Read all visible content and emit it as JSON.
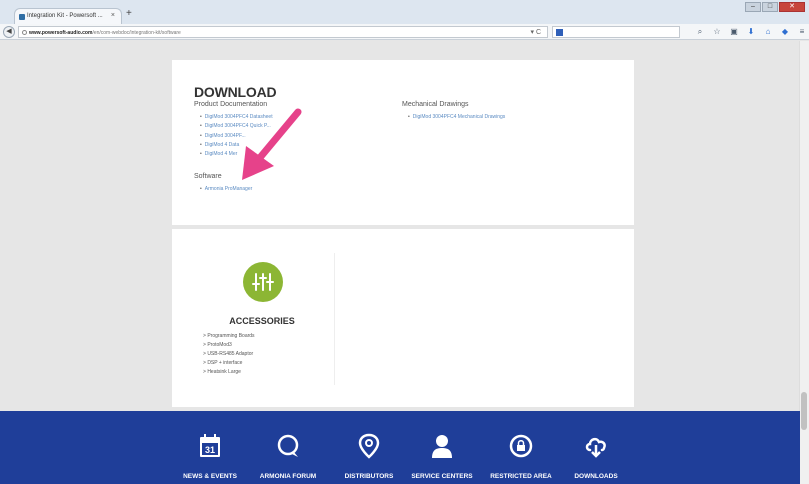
{
  "browser": {
    "tab_title": "Integration Kit - Powersoft ...",
    "tab_close": "×",
    "new_tab": "+",
    "window_controls": {
      "minimize": "–",
      "maximize": "□",
      "close": "✕"
    },
    "url_host": "www.powersoft-audio.com",
    "url_path": "/en/com-webdoc/integration-kit/software",
    "reload_glyph": "▾ C",
    "toolbar_icons": [
      "search-icon",
      "star-icon",
      "bookmarks-icon",
      "download-icon",
      "home-icon",
      "pocket-icon",
      "menu-icon"
    ],
    "toolbar_glyphs": [
      "⌕",
      "☆",
      "▣",
      "⬇",
      "⌂",
      "◆",
      "≡"
    ]
  },
  "download": {
    "title": "DOWNLOAD",
    "product_doc_heading": "Product Documentation",
    "product_docs": [
      "DigiMod 3004PFC4 Datasheet",
      "DigiMod 3004PFC4 Quick P...",
      "DigiMod 3004PF...",
      "DigiMod 4 Data",
      "DigiMod 4 Mer"
    ],
    "software_heading": "Software",
    "software": [
      "Armonia ProManager"
    ],
    "mech_heading": "Mechanical Drawings",
    "mech_drawings": [
      "DigiMod 3004PFC4 Mechanical Drawings"
    ]
  },
  "accessories": {
    "title": "ACCESSORIES",
    "items": [
      "Programming Boards",
      "ProtoMod3",
      "USB-RS485 Adaptor",
      "DSP + interface",
      "Heatsink Large"
    ]
  },
  "footer": {
    "items": [
      {
        "label": "NEWS & EVENTS",
        "icon": "calendar-icon"
      },
      {
        "label": "ARMONIA FORUM",
        "icon": "chat-bubble-icon"
      },
      {
        "label": "DISTRIBUTORS",
        "icon": "map-pin-icon"
      },
      {
        "label": "SERVICE CENTERS",
        "icon": "person-icon"
      },
      {
        "label": "RESTRICTED AREA",
        "icon": "lock-icon"
      },
      {
        "label": "DOWNLOADS",
        "icon": "cloud-download-icon"
      }
    ],
    "calendar_day": "31"
  },
  "colors": {
    "footer_bg": "#1f3e99",
    "accessories_icon": "#8cb634",
    "arrow": "#e6428a",
    "link": "#5b8bc2"
  }
}
